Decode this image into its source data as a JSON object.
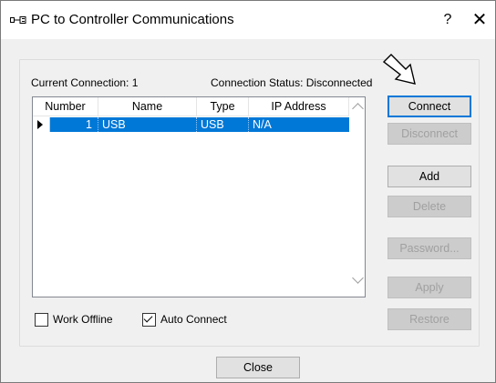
{
  "window": {
    "title": "PC to Controller Communications",
    "help_glyph": "?",
    "close_glyph": "✕"
  },
  "connection": {
    "current": "Current Connection: 1",
    "status": "Connection Status: Disconnected"
  },
  "grid": {
    "columns": [
      "Number",
      "Name",
      "Type",
      "IP Address"
    ],
    "rows": [
      {
        "number": "1",
        "name": "USB",
        "type": "USB",
        "ip": "N/A",
        "selected": true
      }
    ]
  },
  "buttons": {
    "connect": "Connect",
    "disconnect": "Disconnect",
    "add": "Add",
    "delete": "Delete",
    "password": "Password...",
    "apply": "Apply",
    "restore": "Restore",
    "close": "Close"
  },
  "checkboxes": {
    "work_offline": {
      "label": "Work Offline",
      "checked": false
    },
    "auto_connect": {
      "label": "Auto Connect",
      "checked": true
    }
  },
  "colors": {
    "selection": "#0078d7",
    "dialog_bg": "#f0f0f0",
    "disabled_text": "#a0a0a0"
  }
}
